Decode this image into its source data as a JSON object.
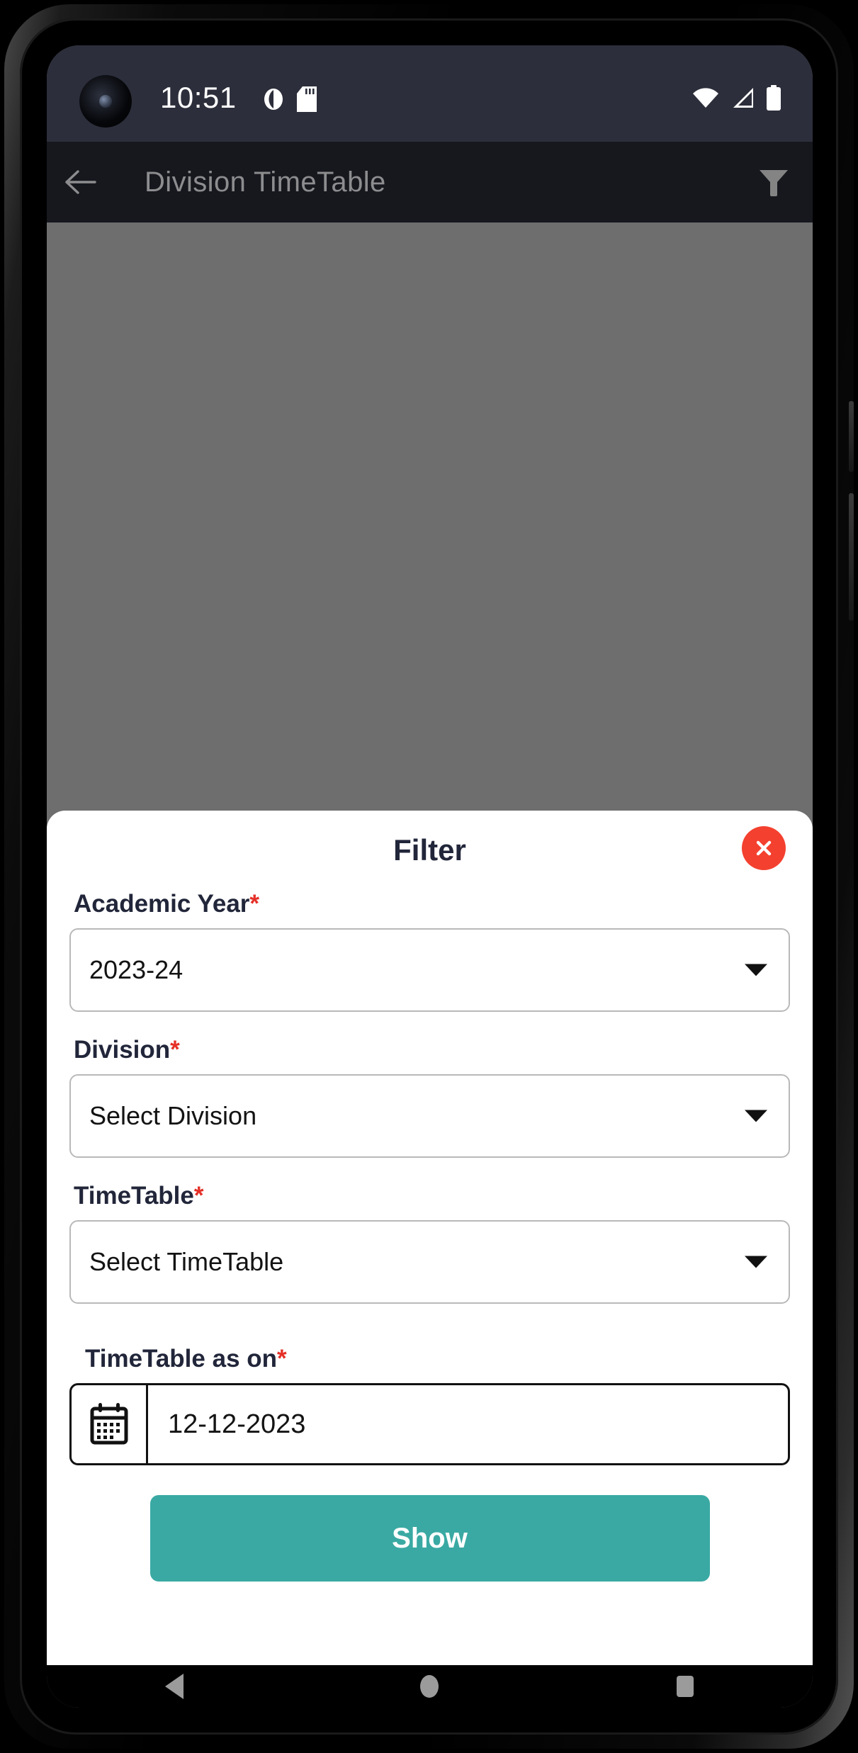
{
  "status_bar": {
    "time": "10:51",
    "left_icons": [
      "do-not-disturb-icon",
      "sd-card-icon"
    ],
    "right_icons": [
      "wifi-icon",
      "cellular-signal-icon",
      "battery-icon"
    ],
    "background_color": "#2c2e3b"
  },
  "app_bar": {
    "back_icon": "arrow-left-icon",
    "title": "Division TimeTable",
    "filter_icon": "filter-funnel-icon",
    "background_color": "#16181e",
    "title_color": "#8d8d8f"
  },
  "scrim": {
    "color": "#6e6e6e"
  },
  "filter_sheet": {
    "title": "Filter",
    "close_icon": "close-icon",
    "close_color": "#f4402f",
    "fields": [
      {
        "label": "Academic Year",
        "required_marker": "*",
        "value": "2023-24",
        "caret_icon": "chevron-down-icon"
      },
      {
        "label": "Division",
        "required_marker": "*",
        "value": "Select Division",
        "caret_icon": "chevron-down-icon"
      },
      {
        "label": "TimeTable",
        "required_marker": "*",
        "value": "Select TimeTable",
        "caret_icon": "chevron-down-icon"
      }
    ],
    "date_field": {
      "label": "TimeTable as on",
      "required_marker": "*",
      "value": "12-12-2023",
      "calendar_icon": "calendar-icon"
    },
    "submit": {
      "label": "Show",
      "color": "#3aa9a3"
    }
  },
  "nav_bar": {
    "back_icon": "triangle-back-icon",
    "home_icon": "circle-home-icon",
    "recents_icon": "square-recents-icon",
    "icon_color": "#9b9b9b"
  }
}
